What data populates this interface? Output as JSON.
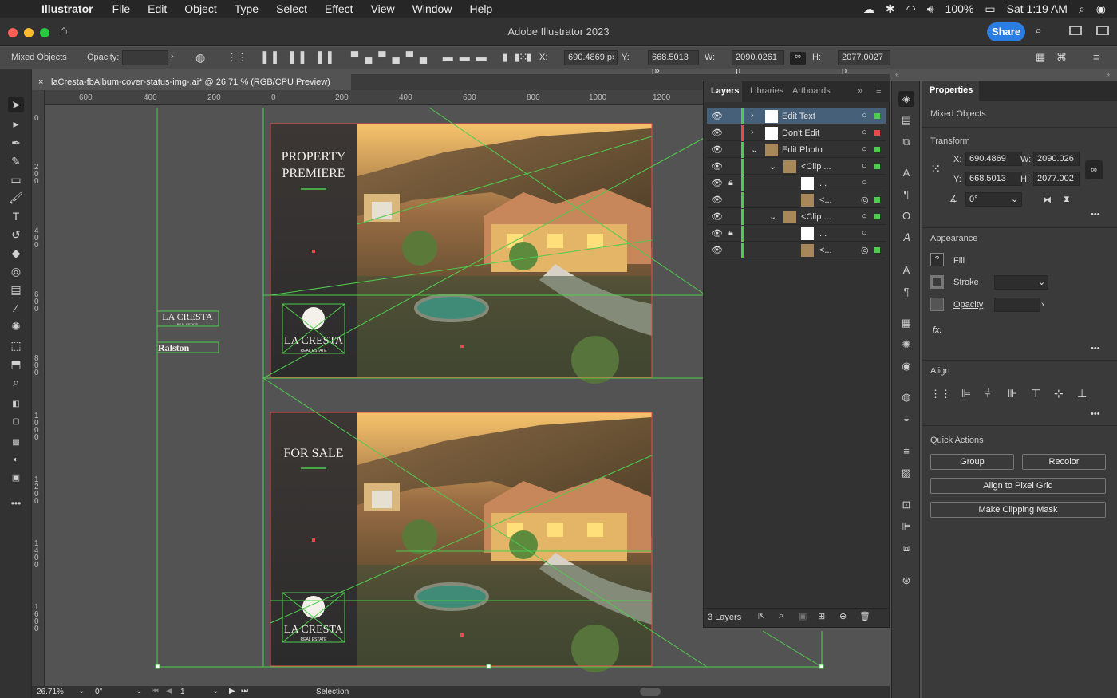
{
  "menubar": {
    "app": "Illustrator",
    "items": [
      "File",
      "Edit",
      "Object",
      "Type",
      "Select",
      "Effect",
      "View",
      "Window",
      "Help"
    ],
    "battery": "100%",
    "clock": "Sat 1:19 AM"
  },
  "window": {
    "title": "Adobe Illustrator 2023",
    "share": "Share"
  },
  "controlbar": {
    "selection_label": "Mixed Objects",
    "opacity_label": "Opacity:",
    "x_label": "X:",
    "x_value": "690.4869 p›",
    "y_label": "Y:",
    "y_value": "668.5013 p›",
    "w_label": "W:",
    "w_value": "2090.0261 p",
    "h_label": "H:",
    "h_value": "2077.0027 p"
  },
  "document": {
    "tab": "laCresta-fbAlbum-cover-status-img-.ai* @ 26.71 % (RGB/CPU Preview)",
    "hruler": [
      "600",
      "400",
      "200",
      "0",
      "200",
      "400",
      "600",
      "800",
      "1000",
      "1200"
    ],
    "vruler": [
      "0",
      "2 0 0",
      "4 0 0",
      "6 0 0",
      "8 0 0",
      "1 0 0 0",
      "1 2 0 0",
      "1 4 0 0",
      "1 6 0 0"
    ]
  },
  "artboard": {
    "top_heading_1": "PROPERTY",
    "top_heading_2": "PREMIERE",
    "bottom_heading": "FOR SALE",
    "logo_main": "LA CRESTA",
    "logo_sub": "REAL ESTATE",
    "side_logo_1": "LA CRESTA",
    "side_logo_1_sub": "REAL ESTATE",
    "side_logo_2": "Ralston"
  },
  "status": {
    "zoom": "26.71%",
    "rotate": "0°",
    "page": "1",
    "tool": "Selection"
  },
  "layers_panel": {
    "tabs": [
      "Layers",
      "Libraries",
      "Artboards"
    ],
    "rows": [
      {
        "name": "Edit Text",
        "color": "#4ecc4e"
      },
      {
        "name": "Don't Edit",
        "color": "#e84b4b"
      },
      {
        "name": "Edit Photo",
        "color": "#4ecc4e"
      },
      {
        "name": "<Clip ...",
        "color": "#4ecc4e"
      },
      {
        "name": "...",
        "color": "#4ecc4e"
      },
      {
        "name": "<...",
        "color": "#4ecc4e"
      },
      {
        "name": "<Clip ...",
        "color": "#4ecc4e"
      },
      {
        "name": "...",
        "color": "#4ecc4e"
      },
      {
        "name": "<...",
        "color": "#4ecc4e"
      }
    ],
    "footer": "3 Layers"
  },
  "properties": {
    "tab": "Properties",
    "selection": "Mixed Objects",
    "transform_title": "Transform",
    "x_label": "X:",
    "x": "690.4869",
    "y_label": "Y:",
    "y": "668.5013",
    "w_label": "W:",
    "w": "2090.026",
    "h_label": "H:",
    "h": "2077.002",
    "angle": "0°",
    "appearance_title": "Appearance",
    "fill_label": "Fill",
    "stroke_label": "Stroke",
    "opacity_label": "Opacity",
    "fx_label": "fx.",
    "align_title": "Align",
    "quick_title": "Quick Actions",
    "btn_group": "Group",
    "btn_recolor": "Recolor",
    "btn_pixel": "Align to Pixel Grid",
    "btn_clip": "Make Clipping Mask"
  }
}
